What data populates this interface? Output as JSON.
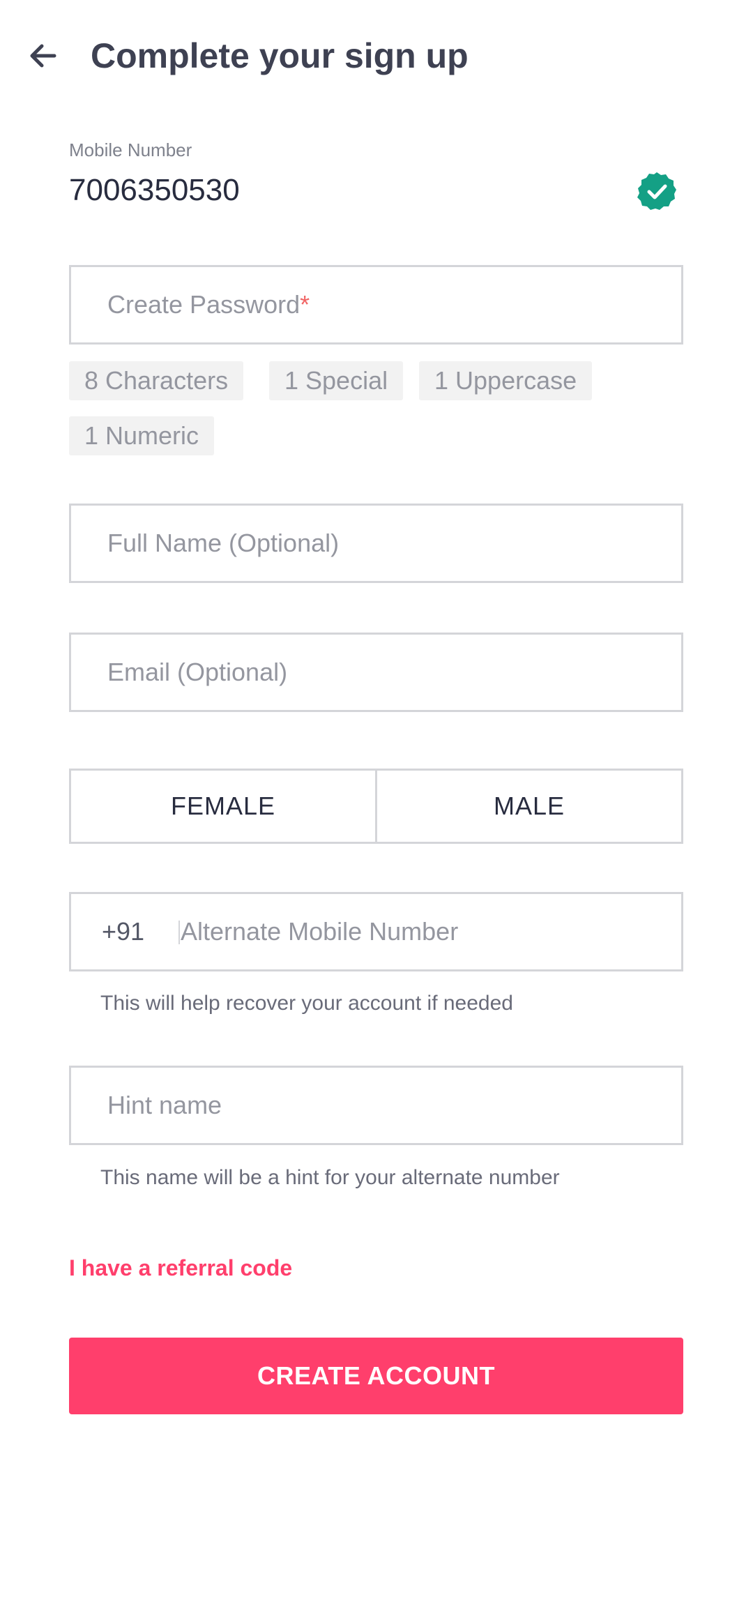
{
  "header": {
    "title": "Complete your sign up",
    "back_icon": "arrow-left-icon"
  },
  "mobile": {
    "label": "Mobile Number",
    "value": "7006350530",
    "verified_icon": "verified-check-icon"
  },
  "password": {
    "placeholder": "Create Password",
    "required_mark": "*",
    "rules": [
      "8 Characters",
      "1 Special",
      "1 Uppercase",
      "1 Numeric"
    ]
  },
  "full_name": {
    "placeholder": "Full Name (Optional)"
  },
  "email": {
    "placeholder": "Email (Optional)"
  },
  "gender": {
    "female": "FEMALE",
    "male": "MALE"
  },
  "alternate": {
    "prefix": "+91",
    "placeholder": "Alternate Mobile Number",
    "helper": "This will help recover your account if needed"
  },
  "hint": {
    "placeholder": "Hint name",
    "helper": "This name will be a hint for your alternate number"
  },
  "referral_link": "I have a referral code",
  "create_button": "CREATE ACCOUNT",
  "colors": {
    "accent": "#ff3f6c",
    "verified": "#14a085",
    "border": "#d4d5d9"
  }
}
